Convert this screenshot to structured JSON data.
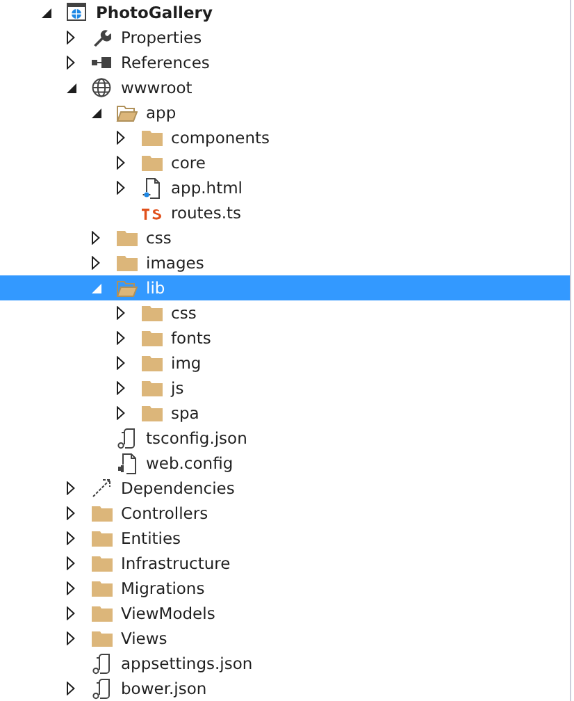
{
  "tree": [
    {
      "label": "PhotoGallery",
      "kind": "project",
      "expanded": true,
      "selected": false,
      "children": [
        {
          "label": "Properties",
          "kind": "properties",
          "expanded": false,
          "selected": false
        },
        {
          "label": "References",
          "kind": "references",
          "expanded": false,
          "selected": false
        },
        {
          "label": "wwwroot",
          "kind": "web",
          "expanded": true,
          "selected": false,
          "children": [
            {
              "label": "app",
              "kind": "folder",
              "expanded": true,
              "selected": false,
              "children": [
                {
                  "label": "components",
                  "kind": "folder",
                  "expanded": false,
                  "selected": false
                },
                {
                  "label": "core",
                  "kind": "folder",
                  "expanded": false,
                  "selected": false
                },
                {
                  "label": "app.html",
                  "kind": "html",
                  "expanded": false,
                  "selected": false
                },
                {
                  "label": "routes.ts",
                  "kind": "ts",
                  "selected": false
                }
              ]
            },
            {
              "label": "css",
              "kind": "folder",
              "expanded": false,
              "selected": false
            },
            {
              "label": "images",
              "kind": "folder",
              "expanded": false,
              "selected": false
            },
            {
              "label": "lib",
              "kind": "folder",
              "expanded": true,
              "selected": true,
              "children": [
                {
                  "label": "css",
                  "kind": "folder",
                  "expanded": false,
                  "selected": false
                },
                {
                  "label": "fonts",
                  "kind": "folder",
                  "expanded": false,
                  "selected": false
                },
                {
                  "label": "img",
                  "kind": "folder",
                  "expanded": false,
                  "selected": false
                },
                {
                  "label": "js",
                  "kind": "folder",
                  "expanded": false,
                  "selected": false
                },
                {
                  "label": "spa",
                  "kind": "folder",
                  "expanded": false,
                  "selected": false
                }
              ]
            },
            {
              "label": "tsconfig.json",
              "kind": "json",
              "selected": false
            },
            {
              "label": "web.config",
              "kind": "config",
              "selected": false
            }
          ]
        },
        {
          "label": "Dependencies",
          "kind": "dependencies",
          "expanded": false,
          "selected": false
        },
        {
          "label": "Controllers",
          "kind": "folder",
          "expanded": false,
          "selected": false
        },
        {
          "label": "Entities",
          "kind": "folder",
          "expanded": false,
          "selected": false
        },
        {
          "label": "Infrastructure",
          "kind": "folder",
          "expanded": false,
          "selected": false
        },
        {
          "label": "Migrations",
          "kind": "folder",
          "expanded": false,
          "selected": false
        },
        {
          "label": "ViewModels",
          "kind": "folder",
          "expanded": false,
          "selected": false
        },
        {
          "label": "Views",
          "kind": "folder",
          "expanded": false,
          "selected": false
        },
        {
          "label": "appsettings.json",
          "kind": "json",
          "selected": false
        },
        {
          "label": "bower.json",
          "kind": "json",
          "expanded": false,
          "selected": false
        }
      ]
    }
  ]
}
